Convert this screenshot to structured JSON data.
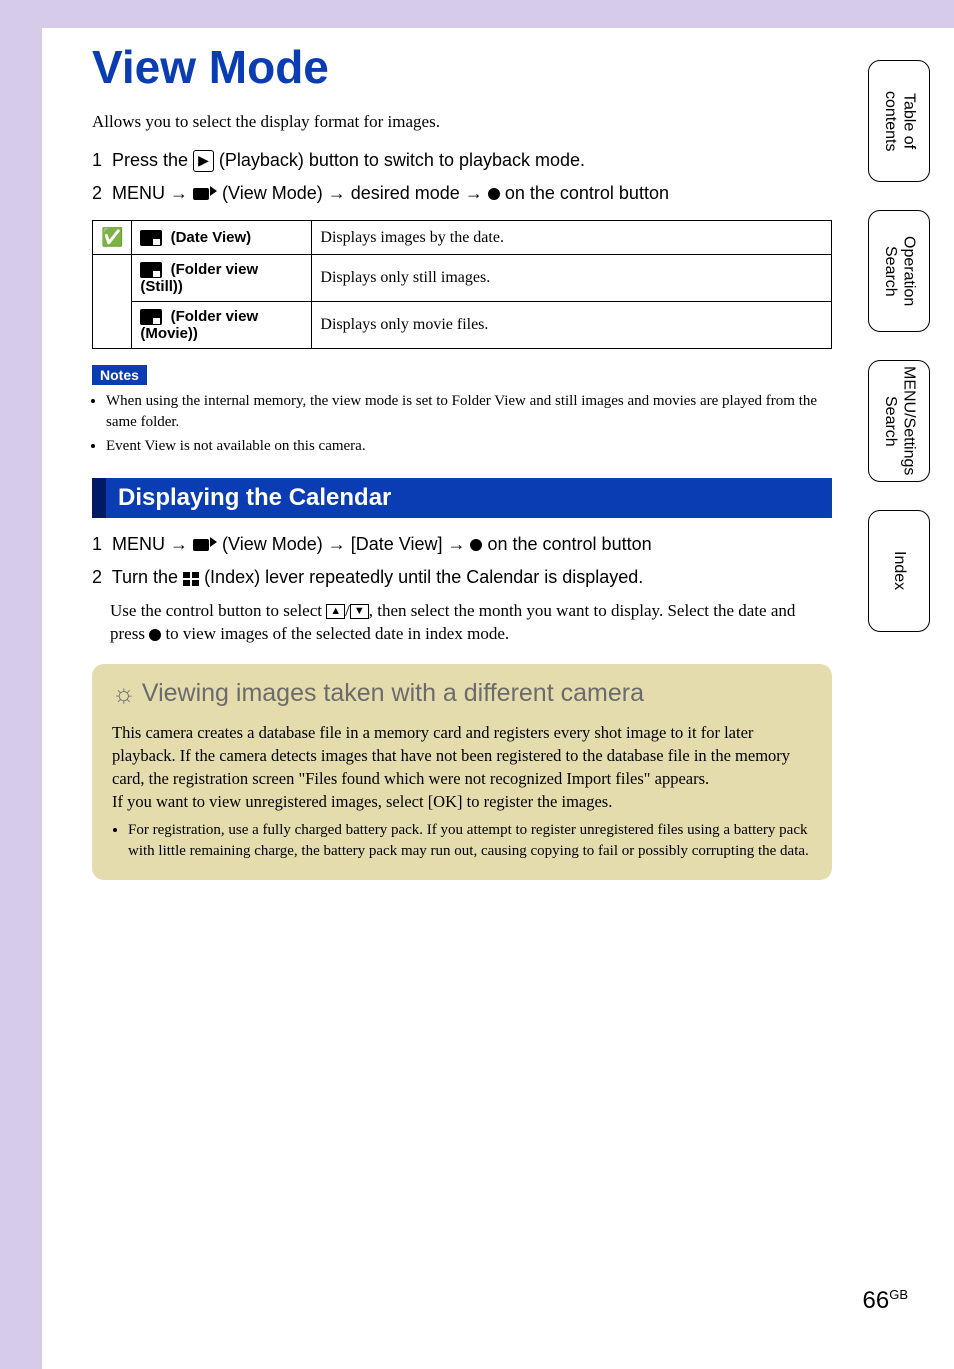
{
  "title": "View Mode",
  "intro": "Allows you to select the display format for images.",
  "steps_top": [
    "Press the ▶ (Playback) button to switch to playback mode.",
    "MENU → (View Mode) → desired mode → ● on the control button"
  ],
  "table": {
    "rows": [
      {
        "checked": true,
        "label": "(Date View)",
        "desc": "Displays images by the date."
      },
      {
        "checked": false,
        "label": "(Folder view (Still))",
        "desc": "Displays only still images."
      },
      {
        "checked": false,
        "label": "(Folder view (Movie))",
        "desc": "Displays only movie files."
      }
    ]
  },
  "notes_label": "Notes",
  "notes": [
    "When using the internal memory, the view mode is set to Folder View and still images and movies are played from the same folder.",
    "Event View is not available on this camera."
  ],
  "section2_title": "Displaying the Calendar",
  "steps_cal": {
    "s1": "MENU → (View Mode) → [Date View] → ● on the control button",
    "s2": "Turn the (Index) lever repeatedly until the Calendar is displayed.",
    "s2_body_a": "Use the control button to select ",
    "s2_body_b": ", then select the month you want to display. Select the date and press ",
    "s2_body_c": " to view images of the selected date in index mode."
  },
  "tip": {
    "title": "Viewing images taken with a different camera",
    "body1": "This camera creates a database file in a memory card and registers every shot image to it for later playback. If the camera detects images that have not been registered to the database file in the memory card, the registration screen \"Files found which were not recognized Import files\" appears.",
    "body2": "If you want to view unregistered images, select [OK] to register the images.",
    "bullet": "For registration, use a fully charged battery pack. If you attempt to register unregistered files using a battery pack with little remaining charge, the battery pack may run out, causing copying to fail or possibly corrupting the data."
  },
  "tabs": [
    "Table of contents",
    "Operation Search",
    "MENU/Settings Search",
    "Index"
  ],
  "page": {
    "num": "66",
    "suffix": "GB"
  }
}
